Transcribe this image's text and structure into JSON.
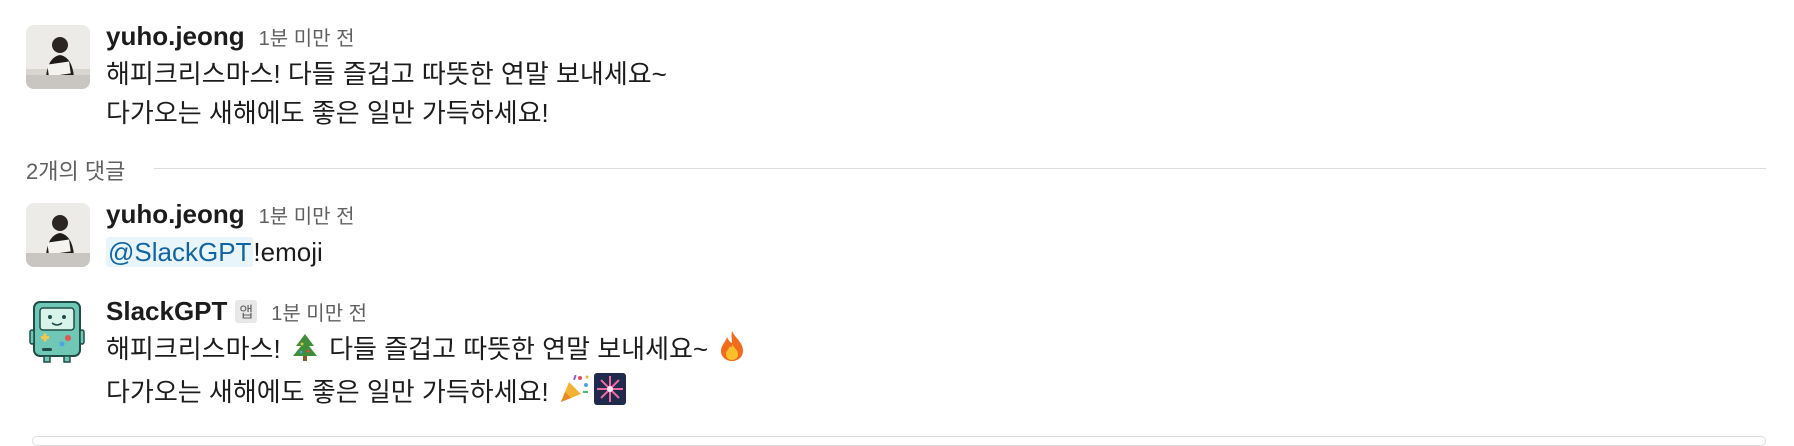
{
  "messages": [
    {
      "author": "yuho.jeong",
      "time": "1분 미만 전",
      "lines": [
        "해피크리스마스! 다들 즐겁고 따뜻한 연말 보내세요~",
        "다가오는 새해에도 좋은 일만 가득하세요!"
      ]
    }
  ],
  "thread": {
    "reply_count_label": "2개의 댓글",
    "replies": [
      {
        "author": "yuho.jeong",
        "time": "1분 미만 전",
        "mention": "@SlackGPT",
        "text": "!emoji"
      },
      {
        "author": "SlackGPT",
        "app_badge": "앱",
        "time": "1분 미만 전",
        "line1_a": "해피크리스마스!",
        "line1_b": "다들 즐겁고 따뜻한 연말 보내세요~",
        "line2": "다가오는 새해에도 좋은 일만 가득하세요!",
        "emojis": [
          "christmas-tree",
          "fire",
          "party-popper",
          "fireworks"
        ]
      }
    ]
  },
  "colors": {
    "mention_text": "#1264a3",
    "mention_bg": "#e8f5fa",
    "timestamp": "#616061",
    "divider": "#dddddd",
    "bot_avatar": "#6fc7b5"
  }
}
